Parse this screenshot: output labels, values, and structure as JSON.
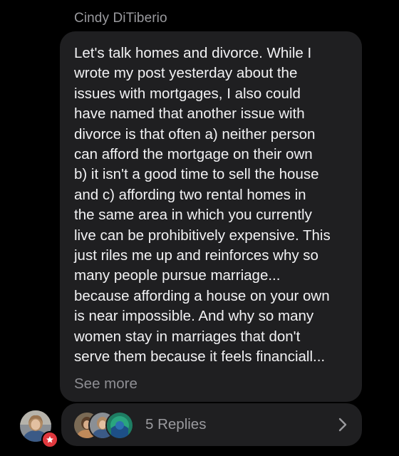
{
  "comment": {
    "author": "Cindy DiTiberio",
    "text": "Let's talk homes and divorce. While I\nwrote my post yesterday about the\nissues with mortgages, I also could\nhave named that another issue with\ndivorce is that often a) neither person\ncan afford the mortgage on their own\nb) it isn't a good time to sell the house\nand c) affording two rental homes in\nthe same area in which you currently\nlive can be prohibitively expensive. This\njust riles me up and reinforces why so\nmany people pursue marriage...\nbecause affording a house on your own\nis near impossible. And why so many\nwomen stay in marriages that don't\nserve them because it feels financiall...",
    "see_more": "See more"
  },
  "replies": {
    "label": "5 Replies"
  },
  "icons": {
    "user_avatar": "avatar",
    "badge": "star-icon",
    "chevron": "chevron-right-icon"
  },
  "colors": {
    "background": "#000000",
    "bubble": "#1f1f21",
    "text": "#f2f2f4",
    "muted": "#9a9a9e",
    "badge": "#e0383e"
  }
}
